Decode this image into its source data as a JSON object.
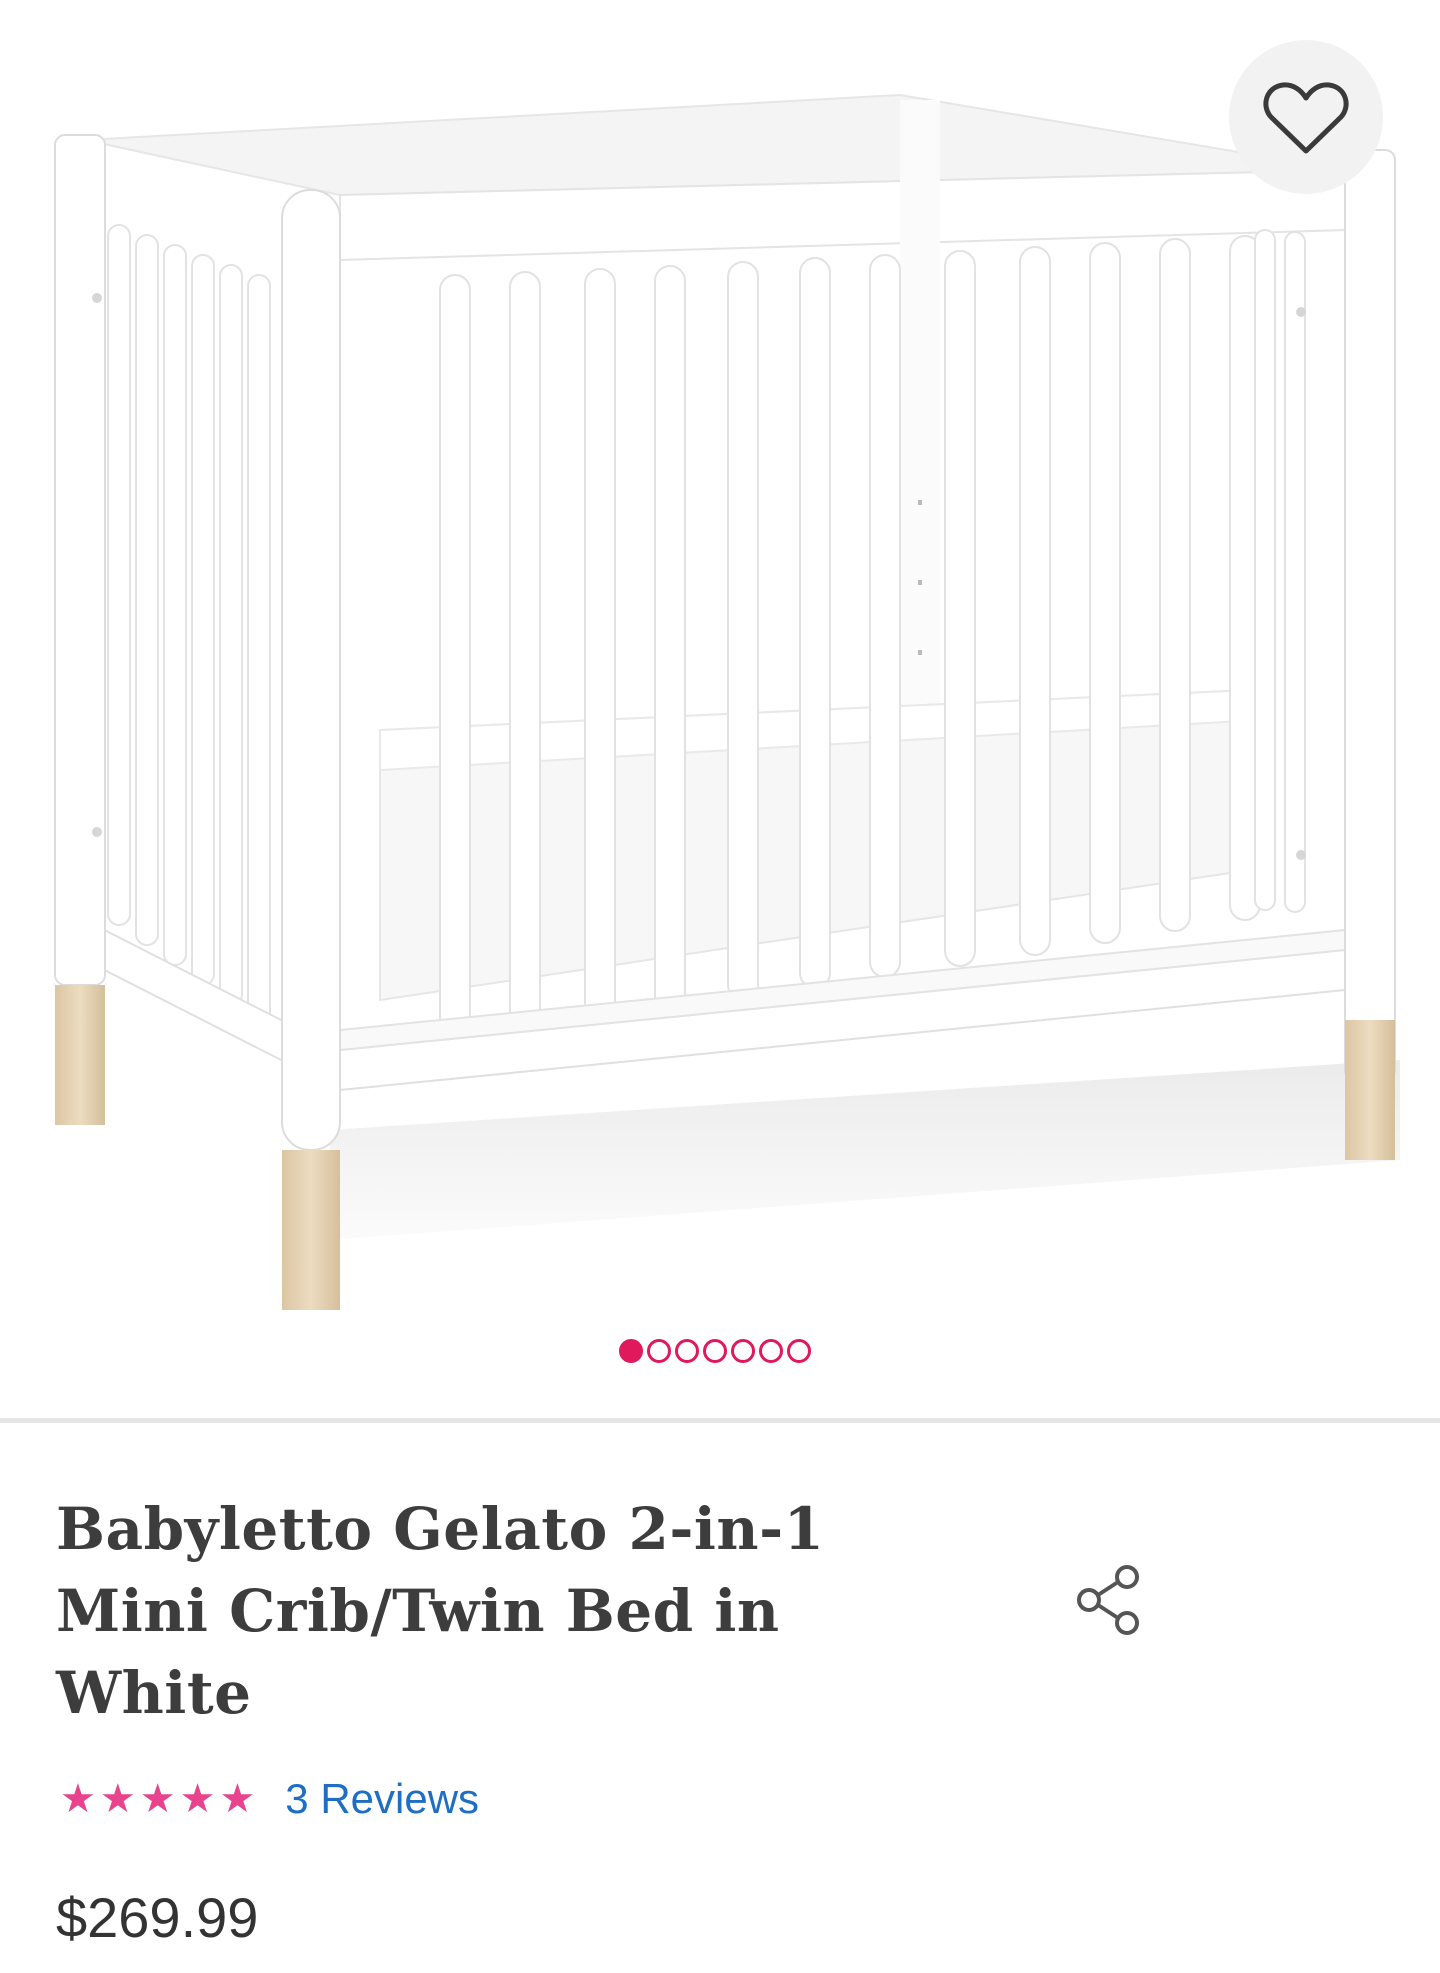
{
  "gallery": {
    "slide_count": 7,
    "active_slide": 1,
    "favorite_icon": "heart-outline-icon"
  },
  "product": {
    "title": "Babyletto Gelato 2-in-1 Mini Crib/Twin Bed in White",
    "rating": 5,
    "rating_max": 5,
    "reviews_label": "3 Reviews",
    "price": "$269.99",
    "share_icon": "share-icon"
  },
  "colors": {
    "accent_pink": "#e0195d",
    "star_pink": "#e8438c",
    "link_blue": "#1e6fc4",
    "crib_white": "#ffffff",
    "crib_legs": "#e8d5b5"
  }
}
